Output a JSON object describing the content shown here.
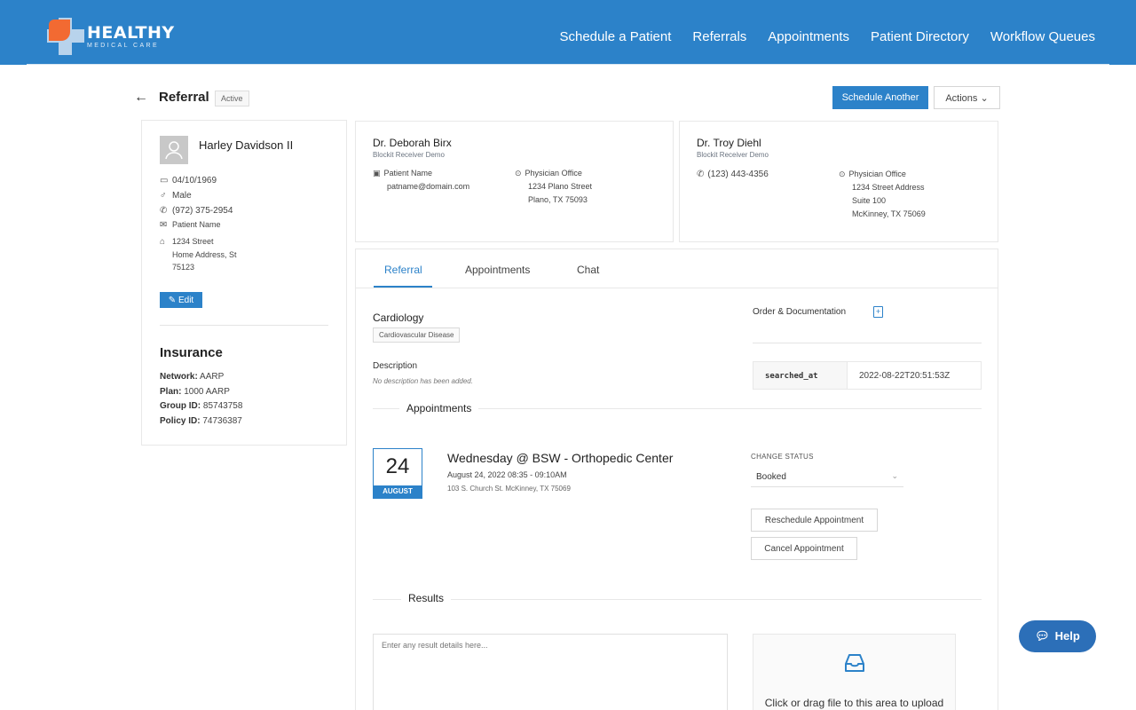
{
  "brand": {
    "name": "HEALTHY",
    "tagline": "MEDICAL CARE"
  },
  "nav": [
    "Schedule a Patient",
    "Referrals",
    "Appointments",
    "Patient Directory",
    "Workflow Queues"
  ],
  "header": {
    "back_icon": "←",
    "title": "Referral",
    "status": "Active",
    "primary_button": "Schedule Another",
    "actions_button": "Actions ⌄"
  },
  "patient": {
    "name": "Harley Davidson II",
    "dob": "04/10/1969",
    "gender": "Male",
    "phone": "(972) 375-2954",
    "email_label": "Patient Name",
    "address": [
      "1234 Street",
      "Home Address, St",
      "75123"
    ],
    "edit_button": "Edit"
  },
  "insurance": {
    "title": "Insurance",
    "rows": [
      {
        "label": "Network:",
        "value": "AARP"
      },
      {
        "label": "Plan:",
        "value": "1000 AARP"
      },
      {
        "label": "Group ID:",
        "value": "85743758"
      },
      {
        "label": "Policy ID:",
        "value": "74736387"
      }
    ]
  },
  "physicians": [
    {
      "name": "Dr. Deborah Birx",
      "org": "Blockit Receiver Demo",
      "contact": [
        "Patient Name",
        "patname@domain.com"
      ],
      "office": [
        "Physician Office",
        "1234 Plano Street",
        "Plano, TX 75093"
      ]
    },
    {
      "name": "Dr. Troy Diehl",
      "org": "Blockit Receiver Demo",
      "phone": "(123) 443-4356",
      "office": [
        "Physician Office",
        "1234 Street Address",
        "Suite 100",
        "McKinney, TX 75069"
      ]
    }
  ],
  "tabs": [
    "Referral",
    "Appointments",
    "Chat"
  ],
  "referral": {
    "specialty": "Cardiology",
    "tag": "Cardiovascular Disease",
    "description_label": "Description",
    "description_value": "No description has been added.",
    "order_label": "Order & Documentation",
    "kv_key": "searched_at",
    "kv_value": "2022-08-22T20:51:53Z"
  },
  "appointments_section": {
    "title": "Appointments",
    "day": "24",
    "month": "AUGUST",
    "appt_title": "Wednesday @ BSW - Orthopedic Center",
    "time": "August 24, 2022 08:35 - 09:10AM",
    "address": "103 S. Church St. McKinney, TX 75069",
    "status_label": "CHANGE STATUS",
    "status_value": "Booked",
    "reschedule": "Reschedule Appointment",
    "cancel": "Cancel Appointment"
  },
  "results": {
    "title": "Results",
    "placeholder": "Enter any result details here...",
    "upload_text": "Click or drag file to this area to upload"
  },
  "help": "Help",
  "colors": {
    "primary": "#2c82c9",
    "accent": "#f26a32"
  }
}
